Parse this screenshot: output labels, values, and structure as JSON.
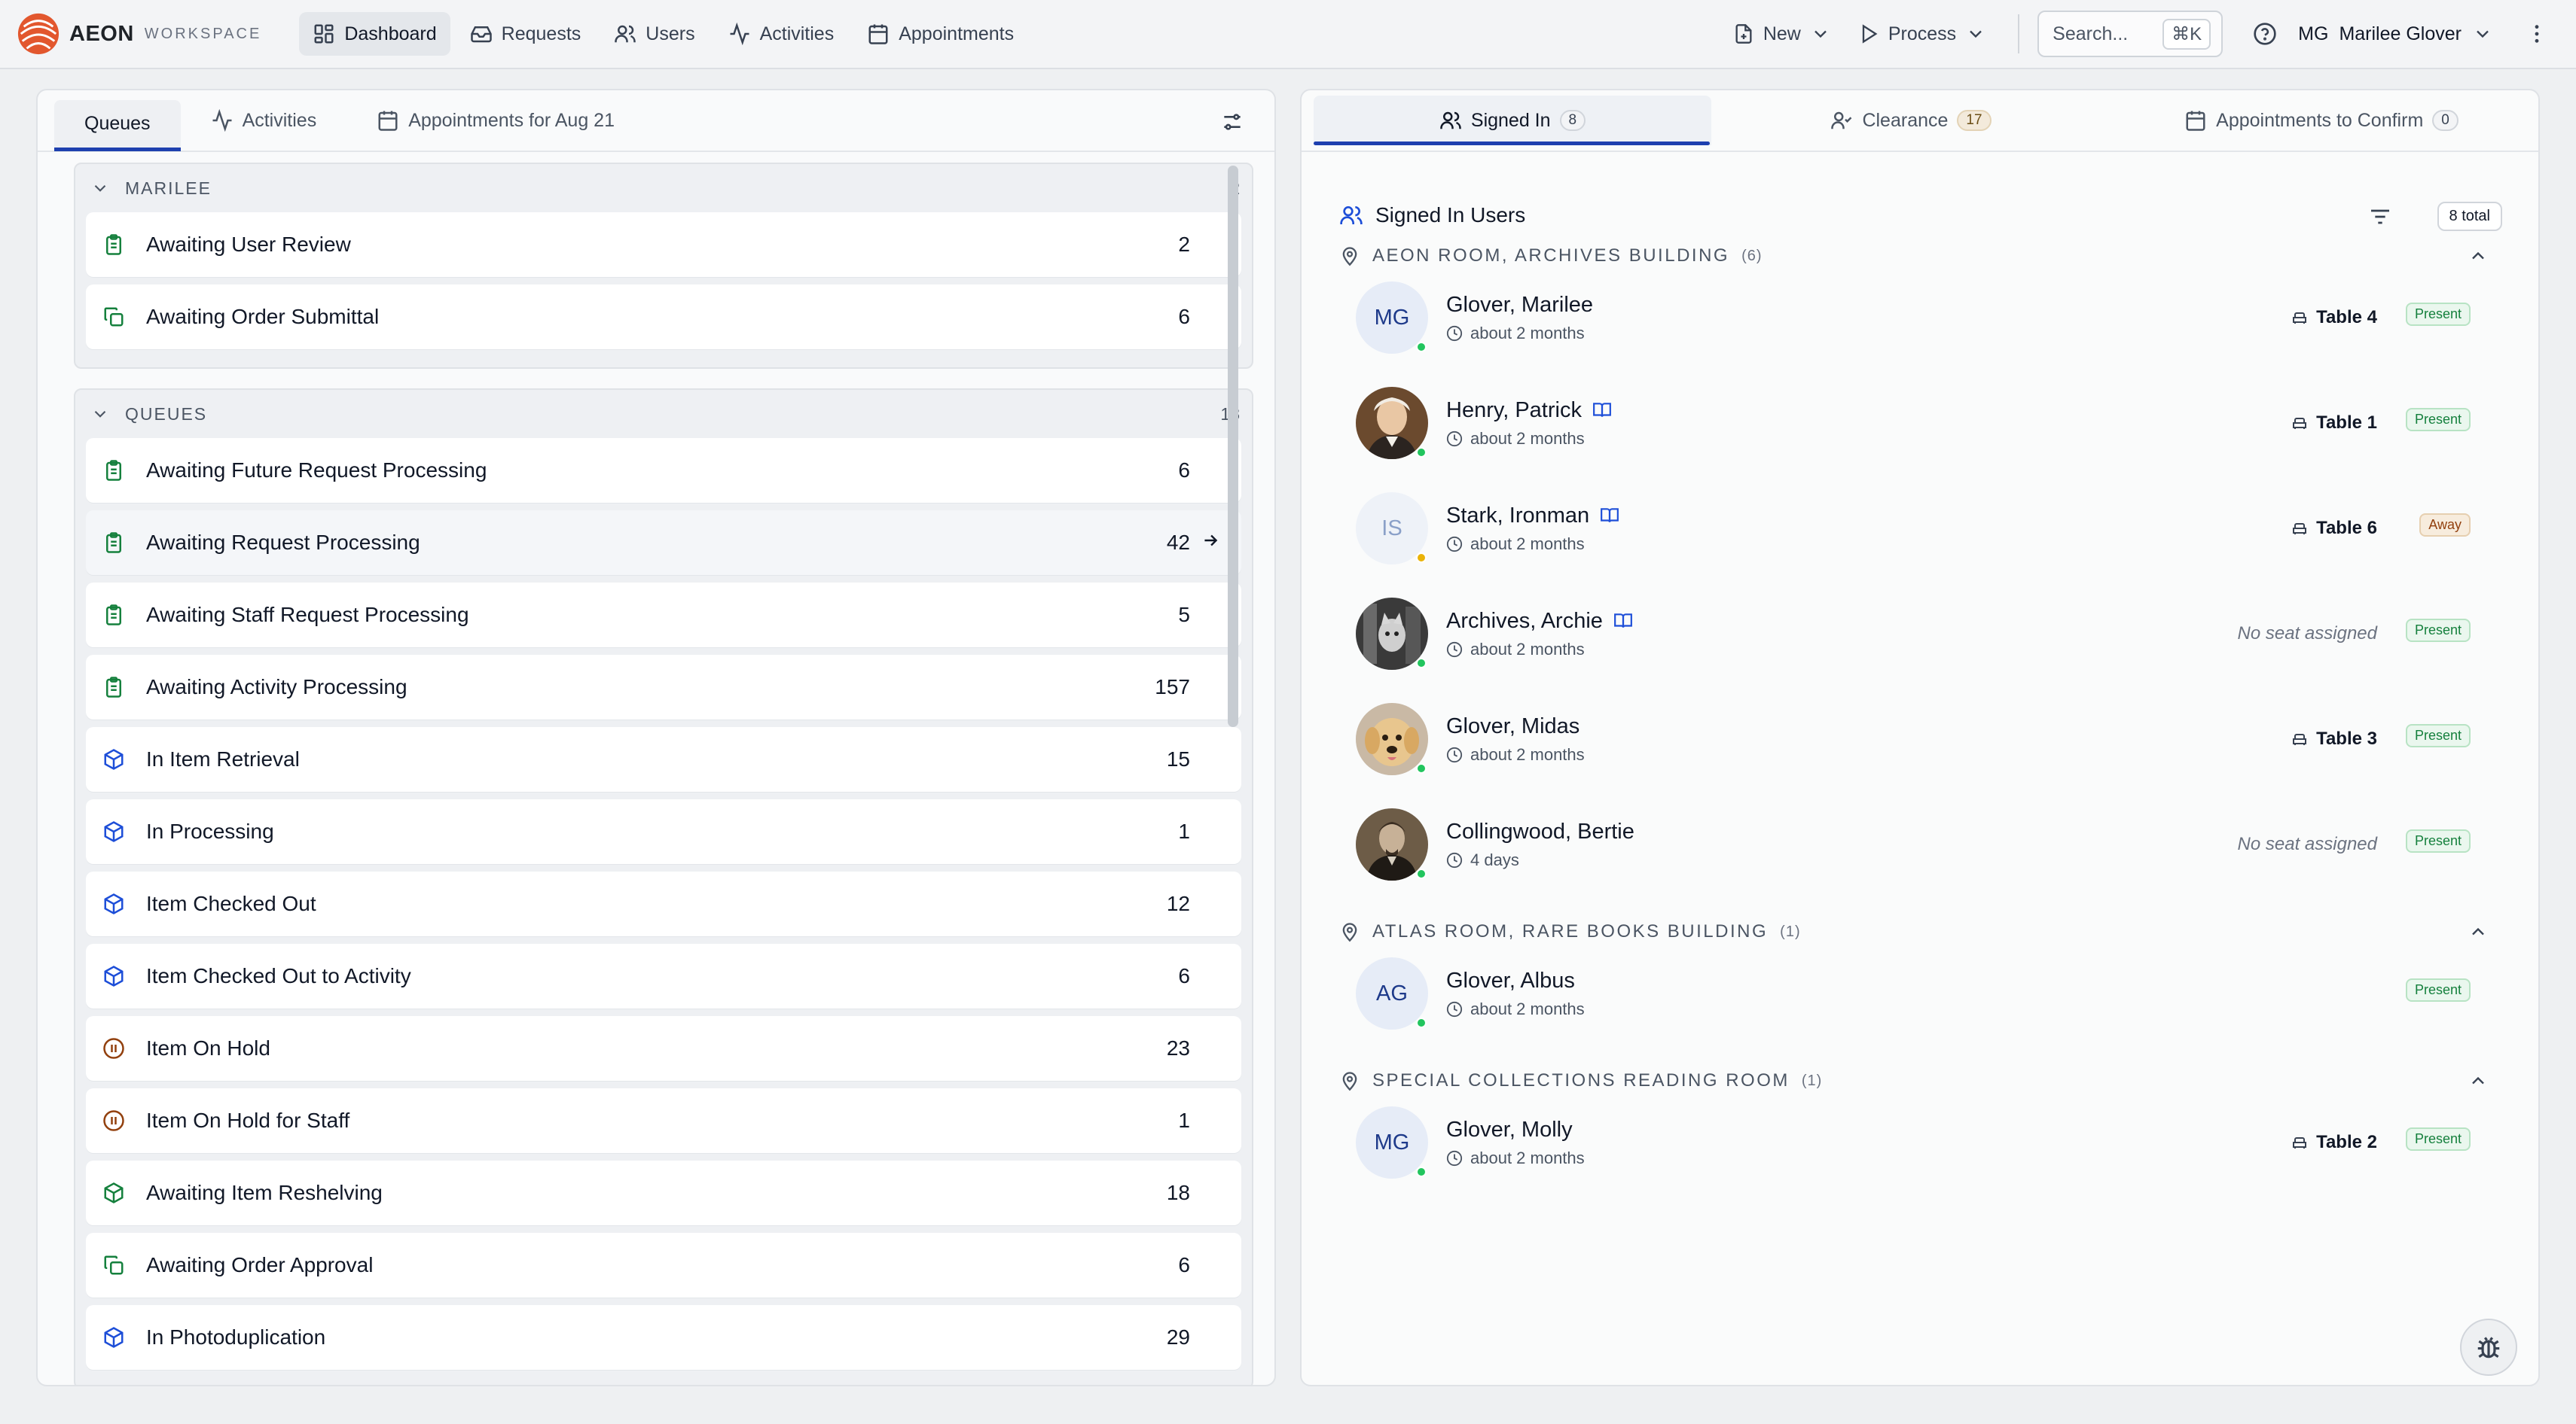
{
  "app": {
    "name": "AEON",
    "subtitle": "WORKSPACE"
  },
  "nav": [
    {
      "label": "Dashboard",
      "icon": "dashboard-icon",
      "active": true
    },
    {
      "label": "Requests",
      "icon": "inbox-icon"
    },
    {
      "label": "Users",
      "icon": "users-icon"
    },
    {
      "label": "Activities",
      "icon": "activity-icon"
    },
    {
      "label": "Appointments",
      "icon": "calendar-icon"
    }
  ],
  "actions": {
    "new_label": "New",
    "process_label": "Process"
  },
  "search": {
    "placeholder": "Search...",
    "shortcut": "⌘K"
  },
  "user": {
    "initials": "MG",
    "name": "Marilee Glover"
  },
  "left_tabs": [
    {
      "label": "Queues",
      "active": true
    },
    {
      "label": "Activities"
    },
    {
      "label": "Appointments for Aug 21"
    }
  ],
  "groups": [
    {
      "title": "MARILEE",
      "count": "2",
      "rows": [
        {
          "label": "Awaiting User Review",
          "count": "2",
          "icon": "clipboard-icon"
        },
        {
          "label": "Awaiting Order Submittal",
          "count": "6",
          "icon": "copy-icon"
        }
      ]
    },
    {
      "title": "QUEUES",
      "count": "18",
      "rows": [
        {
          "label": "Awaiting Future Request Processing",
          "count": "6",
          "icon": "clipboard-icon"
        },
        {
          "label": "Awaiting Request Processing",
          "count": "42",
          "icon": "clipboard-check-icon",
          "highlight": true
        },
        {
          "label": "Awaiting Staff Request Processing",
          "count": "5",
          "icon": "clipboard-check-icon"
        },
        {
          "label": "Awaiting Activity Processing",
          "count": "157",
          "icon": "clipboard-check-icon"
        },
        {
          "label": "In Item Retrieval",
          "count": "15",
          "icon": "package-icon"
        },
        {
          "label": "In Processing",
          "count": "1",
          "icon": "package-icon"
        },
        {
          "label": "Item Checked Out",
          "count": "12",
          "icon": "package-icon"
        },
        {
          "label": "Item Checked Out to Activity",
          "count": "6",
          "icon": "package-icon"
        },
        {
          "label": "Item On Hold",
          "count": "23",
          "icon": "pause-icon"
        },
        {
          "label": "Item On Hold for Staff",
          "count": "1",
          "icon": "pause-icon"
        },
        {
          "label": "Awaiting Item Reshelving",
          "count": "18",
          "icon": "package-green-icon"
        },
        {
          "label": "Awaiting Order Approval",
          "count": "6",
          "icon": "copy-icon"
        },
        {
          "label": "In Photoduplication",
          "count": "29",
          "icon": "package-icon"
        }
      ]
    }
  ],
  "right_tabs": [
    {
      "label": "Signed In",
      "badge": "8",
      "active": true
    },
    {
      "label": "Clearance",
      "badge": "17"
    },
    {
      "label": "Appointments to Confirm",
      "badge": "0"
    }
  ],
  "signed_in": {
    "title": "Signed In Users",
    "total": "8 total",
    "locations": [
      {
        "name": "AEON ROOM, ARCHIVES BUILDING",
        "count": "(6)",
        "users": [
          {
            "initials": "MG",
            "name": "Glover, Marilee",
            "time": "about 2 months",
            "seat": "Table 4",
            "status": "Present"
          },
          {
            "initials": "",
            "name": "Henry, Patrick",
            "time": "about 2 months",
            "seat": "Table 1",
            "status": "Present",
            "book": true,
            "photo": "portrait"
          },
          {
            "initials": "IS",
            "name": "Stark, Ironman",
            "time": "about 2 months",
            "seat": "Table 6",
            "status": "Away",
            "book": true
          },
          {
            "initials": "",
            "name": "Archives, Archie",
            "time": "about 2 months",
            "seat": "No seat assigned",
            "status": "Present",
            "book": true,
            "photo": "bw"
          },
          {
            "initials": "",
            "name": "Glover, Midas",
            "time": "about 2 months",
            "seat": "Table 3",
            "status": "Present",
            "photo": "dog"
          },
          {
            "initials": "",
            "name": "Collingwood, Bertie",
            "time": "4 days",
            "seat": "No seat assigned",
            "status": "Present",
            "photo": "sepia"
          }
        ]
      },
      {
        "name": "ATLAS ROOM, RARE BOOKS BUILDING",
        "count": "(1)",
        "users": [
          {
            "initials": "AG",
            "name": "Glover, Albus",
            "time": "about 2 months",
            "seat": "",
            "status": "Present"
          }
        ]
      },
      {
        "name": "SPECIAL COLLECTIONS READING ROOM",
        "count": "(1)",
        "users": [
          {
            "initials": "MG",
            "name": "Glover, Molly",
            "time": "about 2 months",
            "seat": "Table 2",
            "status": "Present"
          }
        ]
      }
    ]
  },
  "colors": {
    "accent": "#1e40af",
    "present": "#15803d",
    "away": "#92400e",
    "queue_green": "#15803d",
    "queue_blue": "#1d4ed8",
    "queue_brown": "#92400e"
  }
}
